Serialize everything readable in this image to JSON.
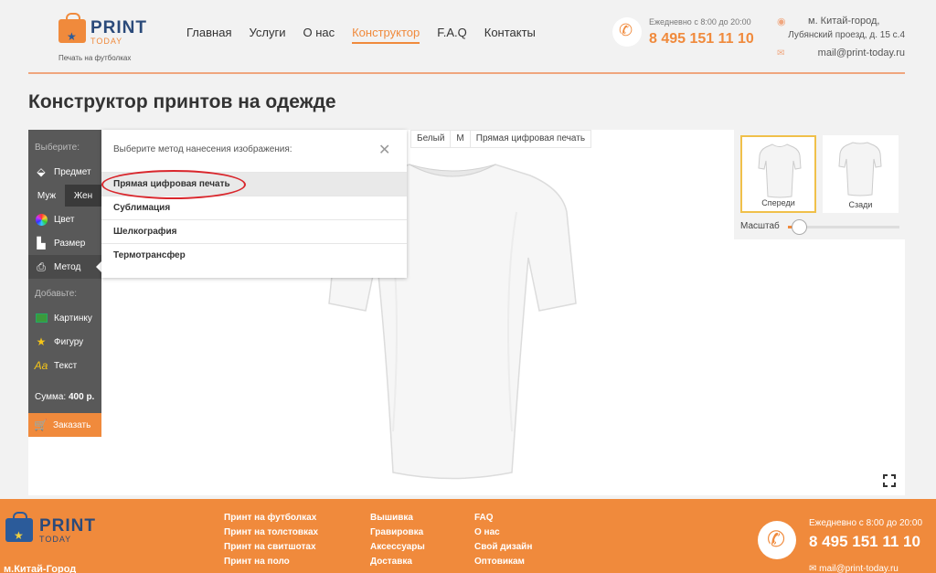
{
  "header": {
    "logo": {
      "print": "PRINT",
      "today": "TODAY",
      "subtitle": "Печать на футболках"
    },
    "nav": [
      {
        "label": "Главная",
        "active": false
      },
      {
        "label": "Услуги",
        "active": false
      },
      {
        "label": "О нас",
        "active": false
      },
      {
        "label": "Конструктор",
        "active": true
      },
      {
        "label": "F.A.Q",
        "active": false
      },
      {
        "label": "Контакты",
        "active": false
      }
    ],
    "hours": "Ежедневно с 8:00 до 20:00",
    "phone": "8 495 151 11 10",
    "address_line1": "м. Китай-город,",
    "address_line2": "Лубянский проезд, д. 15 с.4",
    "email": "mail@print-today.ru"
  },
  "page_title": "Конструктор принтов на одежде",
  "sidebar": {
    "choose_label": "Выберите:",
    "item_subject": "Предмет",
    "gender_male": "Муж",
    "gender_female": "Жен",
    "item_color": "Цвет",
    "item_size": "Размер",
    "item_method": "Метод",
    "add_label": "Добавьте:",
    "item_picture": "Картинку",
    "item_shape": "Фигуру",
    "item_text": "Текст",
    "sum_label": "Сумма:",
    "sum_value": "400 р.",
    "order_label": "Заказать"
  },
  "info_bar": {
    "color": "Белый",
    "size": "M",
    "method": "Прямая цифровая печать"
  },
  "method_dropdown": {
    "title": "Выберите метод нанесения изображения:",
    "options": [
      {
        "label": "Прямая цифровая печать",
        "selected": true
      },
      {
        "label": "Сублимация",
        "selected": false
      },
      {
        "label": "Шелкография",
        "selected": false
      },
      {
        "label": "Термотрансфер",
        "selected": false
      }
    ]
  },
  "views": {
    "front": "Спереди",
    "back": "Сзади"
  },
  "scale": {
    "label": "Масштаб",
    "value": 0.1
  },
  "colors": {
    "accent": "#f08a3c",
    "sidebar": "#595959",
    "highlight_circle": "#d9262c"
  },
  "footer": {
    "logo_print": "PRINT",
    "logo_today": "TODAY",
    "metro": "м.Китай-Город",
    "col1": [
      "Принт на футболках",
      "Принт на толстовках",
      "Принт на свитшотах",
      "Принт на поло"
    ],
    "col2": [
      "Вышивка",
      "Гравировка",
      "Аксессуары",
      "Доставка"
    ],
    "col3": [
      "FAQ",
      "О нас",
      "Свой дизайн",
      "Оптовикам"
    ],
    "hours": "Ежедневно с 8:00 до 20:00",
    "phone": "8 495 151 11 10",
    "email": "mail@print-today.ru"
  }
}
